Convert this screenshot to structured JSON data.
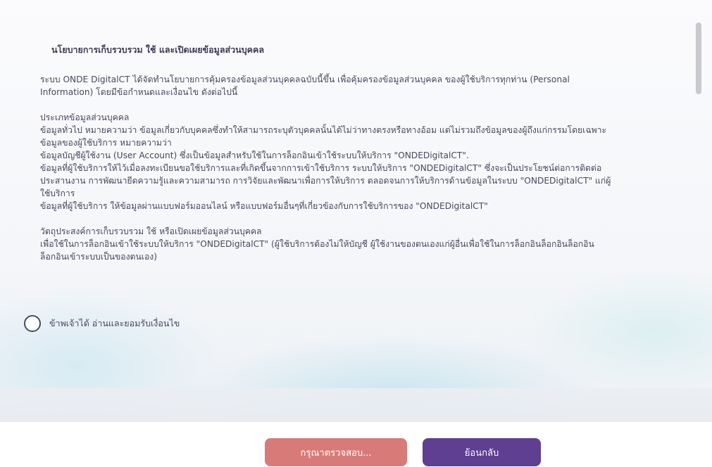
{
  "policy": {
    "title": "นโยบายการเก็บรวบรวม ใช้ และเปิดเผยข้อมูลส่วนบุคคล",
    "intro": "ระบบ ONDE DigitalCT ได้จัดทำนโยบายการคุ้มครองข้อมูลส่วนบุคคลฉบับนี้ขึ้น เพื่อคุ้มครองข้อมูลส่วนบุคคล ของผู้ใช้บริการทุกท่าน (Personal\nInformation) โดยมีข้อกำหนดและเงื่อนไข ดังต่อไปนี้",
    "section1_heading": "ประเภทข้อมูลส่วนบุคคล",
    "section1_body": "ข้อมูลทั่วไป หมายความว่า ข้อมูลเกี่ยวกับบุคคลซึ่งทำให้สามารถระบุตัวบุคคลนั้นได้ไม่ว่าทางตรงหรือทางอ้อม แต่ไม่รวมถึงข้อมูลของผู้ถึงแก่กรรมโดยเฉพาะ\nข้อมูลของผู้ใช้บริการ หมายความว่า\nข้อมูลบัญชีผู้ใช้งาน (User Account) ซึ่งเป็นข้อมูลสำหรับใช้ในการล็อกอินเข้าใช้ระบบให้บริการ \"ONDEDigitalCT\".\nข้อมูลที่ผู้ใช้บริการให้ไว้เมื่อลงทะเบียนขอใช้บริการและที่เกิดขึ้นจากการเข้าใช้บริการ ระบบให้บริการ \"ONDEDigitalCT\" ซึ่งจะเป็นประโยชน์ต่อการติดต่อ\nประสานงาน การพัฒนายีดความรู้และความสามารถ การวิจัยและพัฒนาเพื่อการให้บริการ ตลอดจนการให้บริการด้านข้อมูลในระบบ \"ONDEDigitalCT\" แก่ผู้\nใช้บริการ\nข้อมูลที่ผู้ใช้บริการ ให้ข้อมูลผ่านแบบฟอร์มออนไลน์ หรือแบบฟอร์มอื่นๆที่เกี่ยวข้องกับการใช้บริการของ \"ONDEDigitalCT\"",
    "section2_heading": "วัตถุประสงค์การเก็บรวบรวม ใช้ หรือเปิดเผยข้อมูลส่วนบุคคล",
    "section2_body": "เพื่อใช้ในการล็อกอินเข้าใช้ระบบให้บริการ \"ONDEDigitalCT\" (ผู้ใช้บริการต้องไม่ให้บัญชี ผู้ใช้งานของตนเองแก่ผู้อื่นเพื่อใช้ในการล็อกอินล็อกอินล็อกอิน\nล็อกอินเข้าระบบเป็นของตนเอง)"
  },
  "consent": {
    "label": "ข้าพเจ้าได้ อ่านและยอมรับเงื่อนไข"
  },
  "buttons": {
    "check_label": "กรุณาตรวจสอบ...",
    "back_label": "ย้อนกลับ"
  },
  "colors": {
    "check_button": "#d87b78",
    "back_button": "#5e3f91"
  }
}
